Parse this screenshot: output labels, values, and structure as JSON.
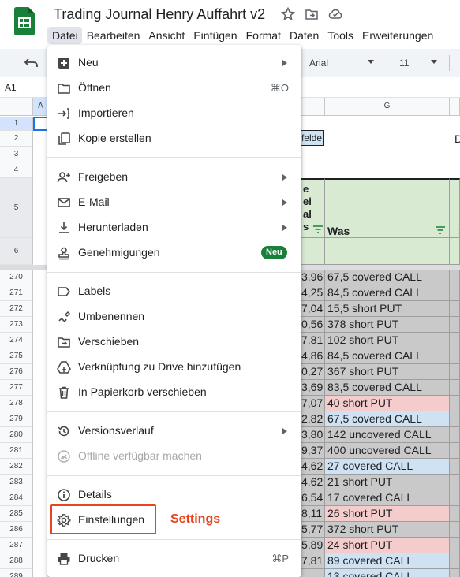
{
  "app": {
    "title": "Trading Journal Henry Auffahrt v2",
    "brand_color": "#188038"
  },
  "menubar": [
    {
      "label": "Datei"
    },
    {
      "label": "Bearbeiten"
    },
    {
      "label": "Ansicht"
    },
    {
      "label": "Einfügen"
    },
    {
      "label": "Format"
    },
    {
      "label": "Daten"
    },
    {
      "label": "Tools"
    },
    {
      "label": "Erweiterungen"
    }
  ],
  "toolbar": {
    "font": "Arial",
    "font_size": "11"
  },
  "namebox": "A1",
  "columns": {
    "a": "A",
    "g": "G"
  },
  "header_cells": {
    "felde": "felde",
    "d": "D",
    "lines": [
      "e",
      "ei",
      "al",
      "s"
    ],
    "was": "Was",
    "s": "S"
  },
  "row_numbers_top": [
    "1",
    "2",
    "3",
    "4",
    "5",
    "6"
  ],
  "rows": [
    {
      "num": "270",
      "value": "3,96",
      "text": "67,5 covered CALL",
      "fill": "gray"
    },
    {
      "num": "271",
      "value": "4,25",
      "text": "84,5 covered CALL",
      "fill": "gray"
    },
    {
      "num": "272",
      "value": "7,04",
      "text": "15,5 short PUT",
      "fill": "gray"
    },
    {
      "num": "273",
      "value": "0,56",
      "text": "378 short PUT",
      "fill": "gray"
    },
    {
      "num": "274",
      "value": "7,81",
      "text": "102 short PUT",
      "fill": "gray"
    },
    {
      "num": "275",
      "value": "4,86",
      "text": "84,5 covered CALL",
      "fill": "gray"
    },
    {
      "num": "276",
      "value": "0,27",
      "text": "367 short PUT",
      "fill": "gray"
    },
    {
      "num": "277",
      "value": "3,69",
      "text": "83,5 covered CALL",
      "fill": "gray"
    },
    {
      "num": "278",
      "value": "7,07",
      "text": "40 short PUT",
      "fill": "red"
    },
    {
      "num": "279",
      "value": "2,82",
      "text": "67,5 covered CALL",
      "fill": "blue"
    },
    {
      "num": "280",
      "value": "3,80",
      "text": "142 uncovered CALL",
      "fill": "gray"
    },
    {
      "num": "281",
      "value": "9,37",
      "text": "400 uncovered CALL",
      "fill": "gray"
    },
    {
      "num": "282",
      "value": "4,62",
      "text": "27 covered CALL",
      "fill": "blue"
    },
    {
      "num": "283",
      "value": "4,62",
      "text": "21 short PUT",
      "fill": "gray"
    },
    {
      "num": "284",
      "value": "6,54",
      "text": "17 covered CALL",
      "fill": "gray"
    },
    {
      "num": "285",
      "value": "8,11",
      "text": "26 short PUT",
      "fill": "red"
    },
    {
      "num": "286",
      "value": "5,77",
      "text": "372 short PUT",
      "fill": "gray"
    },
    {
      "num": "287",
      "value": "5,89",
      "text": "24 short PUT",
      "fill": "red"
    },
    {
      "num": "288",
      "value": "7,81",
      "text": "89 covered CALL",
      "fill": "blue"
    },
    {
      "num": "289",
      "value": "",
      "text": "13 covered CALL",
      "fill": "blue"
    }
  ],
  "file_menu": {
    "items": [
      {
        "label": "Neu",
        "icon": "plus-square-icon",
        "submenu": true
      },
      {
        "label": "Öffnen",
        "icon": "folder-icon",
        "shortcut": "⌘O"
      },
      {
        "label": "Importieren",
        "icon": "import-icon"
      },
      {
        "label": "Kopie erstellen",
        "icon": "copy-icon"
      },
      {
        "label": "Freigeben",
        "icon": "person-add-icon",
        "submenu": true
      },
      {
        "label": "E-Mail",
        "icon": "mail-icon",
        "submenu": true
      },
      {
        "label": "Herunterladen",
        "icon": "download-icon",
        "submenu": true
      },
      {
        "label": "Genehmigungen",
        "icon": "approval-icon",
        "badge": "Neu"
      },
      {
        "label": "Labels",
        "icon": "label-icon"
      },
      {
        "label": "Umbenennen",
        "icon": "rename-icon"
      },
      {
        "label": "Verschieben",
        "icon": "move-folder-icon"
      },
      {
        "label": "Verknüpfung zu Drive hinzufügen",
        "icon": "drive-shortcut-icon"
      },
      {
        "label": "In Papierkorb verschieben",
        "icon": "trash-icon"
      },
      {
        "label": "Versionsverlauf",
        "icon": "history-icon",
        "submenu": true
      },
      {
        "label": "Offline verfügbar machen",
        "icon": "offline-icon",
        "disabled": true
      },
      {
        "label": "Details",
        "icon": "info-icon"
      },
      {
        "label": "Einstellungen",
        "icon": "gear-icon"
      },
      {
        "label": "Drucken",
        "icon": "printer-icon",
        "shortcut": "⌘P"
      }
    ]
  },
  "annotation": {
    "text": "Settings",
    "color": "#e8451c"
  }
}
